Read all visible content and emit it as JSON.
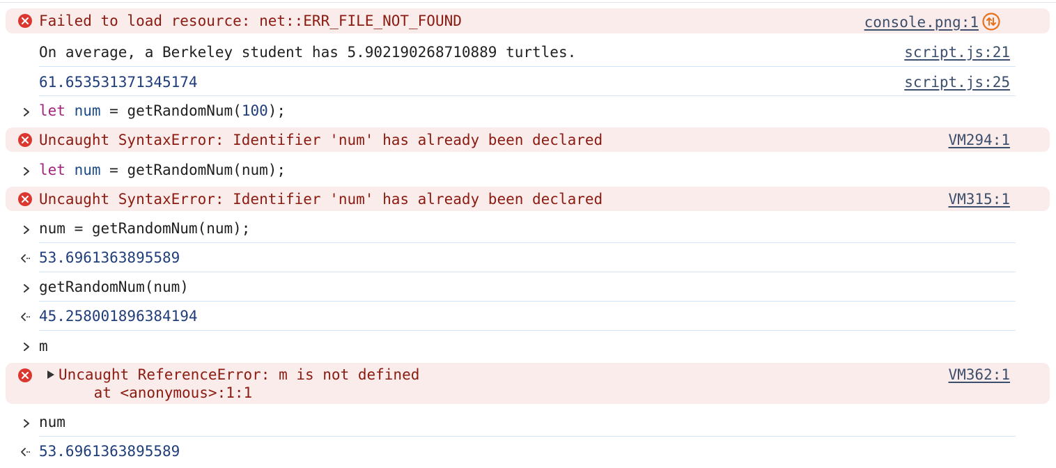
{
  "rows": [
    {
      "kind": "error",
      "text": "Failed to load resource: net::ERR_FILE_NOT_FOUND",
      "source": "console.png:1",
      "icon": "error-icon",
      "extra_icon": "network-request-icon"
    },
    {
      "kind": "log",
      "text": "On average, a Berkeley student has 5.902190268710889 turtles.",
      "source": "script.js:21"
    },
    {
      "kind": "log",
      "text": "61.653531371345174",
      "source": "script.js:25"
    },
    {
      "kind": "input",
      "code": {
        "keyword": "let",
        "variable": "num",
        "rest_a": " = getRandomNum(",
        "number": "100",
        "rest_b": ");"
      }
    },
    {
      "kind": "error",
      "text": "Uncaught SyntaxError: Identifier 'num' has already been declared",
      "source": "VM294:1",
      "icon": "error-icon"
    },
    {
      "kind": "input",
      "code": {
        "keyword": "let",
        "variable": "num",
        "rest": " = getRandomNum(num);"
      }
    },
    {
      "kind": "error",
      "text": "Uncaught SyntaxError: Identifier 'num' has already been declared",
      "source": "VM315:1",
      "icon": "error-icon"
    },
    {
      "kind": "input",
      "text": "num = getRandomNum(num);"
    },
    {
      "kind": "result",
      "text": "53.6961363895589"
    },
    {
      "kind": "input",
      "text": "getRandomNum(num)"
    },
    {
      "kind": "result",
      "text": "45.258001896384194"
    },
    {
      "kind": "input",
      "text": "m"
    },
    {
      "kind": "error",
      "text": "Uncaught ReferenceError: m is not defined",
      "stack": "    at <anonymous>:1:1",
      "source": "VM362:1",
      "icon": "error-icon",
      "expandable": true
    },
    {
      "kind": "input",
      "text": "num"
    },
    {
      "kind": "result",
      "text": "53.6961363895589"
    }
  ],
  "colors": {
    "error_bg": "#fbecec",
    "error_text": "#8b1a10",
    "error_icon": "#dc362e",
    "number": "#1f3d7a",
    "keyword": "#a3237f",
    "network_icon": "#e8711a"
  }
}
